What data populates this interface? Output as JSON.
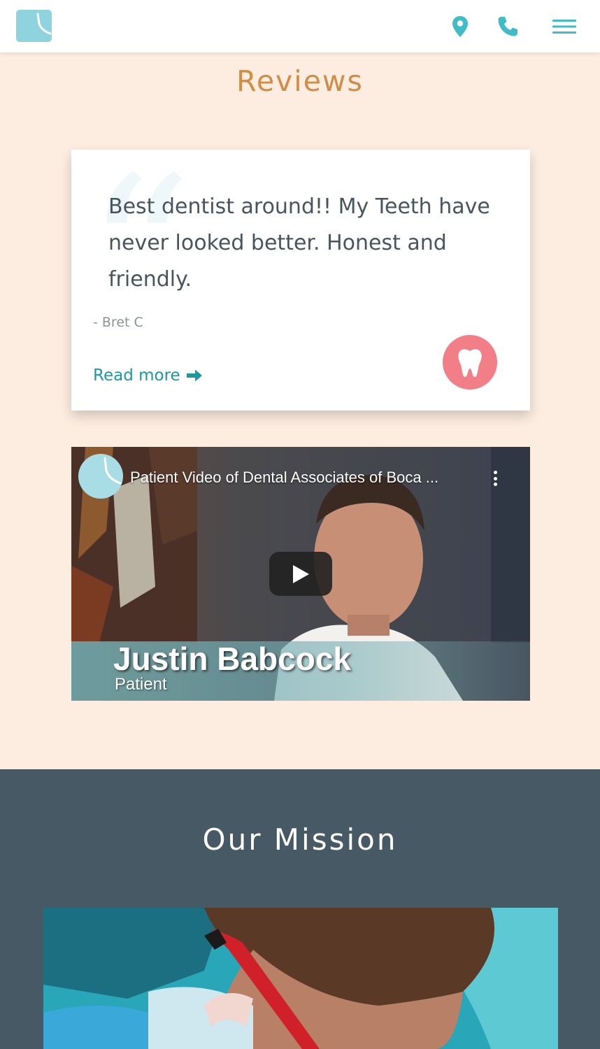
{
  "header": {
    "logo": "logo-mark",
    "icons": [
      "location-pin-icon",
      "phone-icon",
      "hamburger-menu-icon"
    ]
  },
  "reviews": {
    "title": "Reviews",
    "card": {
      "text": "Best dentist around!! My Teeth have never looked better. Honest and friendly.",
      "author": "- Bret C",
      "read_more": "Read more",
      "badge_icon": "tooth-icon"
    }
  },
  "video": {
    "title": "Patient Video of Dental Associates of Boca ...",
    "person_name": "Justin Babcock",
    "person_role": "Patient",
    "play_icon": "play-icon",
    "more_icon": "more-vertical-icon"
  },
  "mission": {
    "title": "Our Mission"
  },
  "colors": {
    "accent_teal": "#1a9aa0",
    "logo_blue": "#8fd3df",
    "reviews_title": "#d08d46",
    "page_bg": "#fdece0",
    "mission_bg": "#475964",
    "tooth_badge": "#f27e87"
  }
}
